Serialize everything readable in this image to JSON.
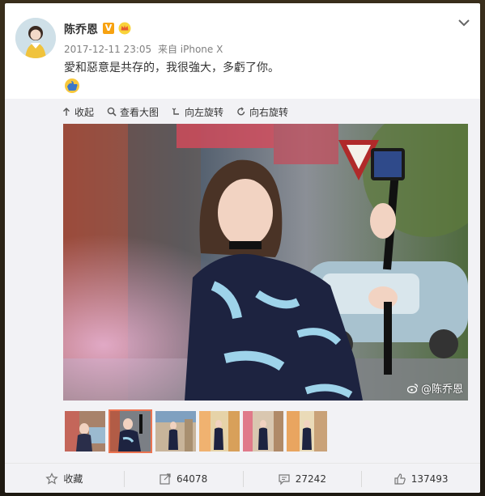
{
  "post": {
    "username": "陈乔恩",
    "verified_badge": "V",
    "timestamp": "2017-12-11 23:05",
    "source": "来自 iPhone X",
    "text": "愛和惡意是共存的，我很強大，多虧了你。"
  },
  "toolbar": {
    "collapse": "收起",
    "view_large": "查看大图",
    "rotate_left": "向左旋转",
    "rotate_right": "向右旋转"
  },
  "photo": {
    "watermark": "@陈乔恩"
  },
  "actions": {
    "favorite": "收藏",
    "repost_count": "64078",
    "comment_count": "27242",
    "like_count": "137493"
  },
  "colors": {
    "accent": "#eb7350",
    "verified": "#f7a211",
    "text": "#333333",
    "muted": "#808080"
  }
}
